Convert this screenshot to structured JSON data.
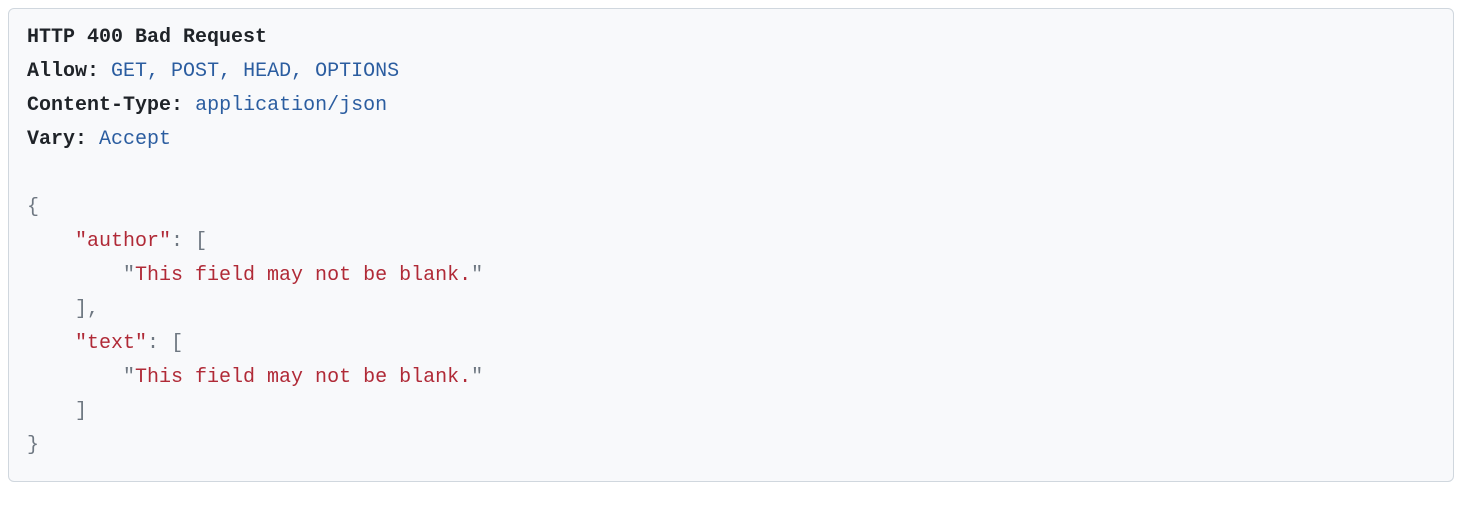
{
  "response": {
    "status_line": "HTTP 400 Bad Request",
    "headers": [
      {
        "name": "Allow",
        "value": "GET, POST, HEAD, OPTIONS"
      },
      {
        "name": "Content-Type",
        "value": "application/json"
      },
      {
        "name": "Vary",
        "value": "Accept"
      }
    ],
    "body": {
      "author": [
        "This field may not be blank."
      ],
      "text": [
        "This field may not be blank."
      ]
    }
  }
}
